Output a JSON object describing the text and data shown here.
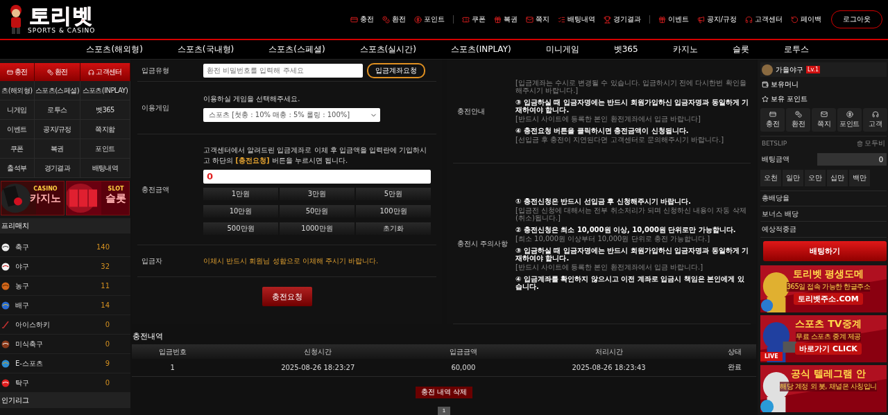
{
  "logo": {
    "title": "토리벳",
    "subtitle": "SPORTS & CASINO"
  },
  "top_links": [
    {
      "label": "충전"
    },
    {
      "label": "환전"
    },
    {
      "label": "포인트"
    },
    {
      "label": "쿠폰"
    },
    {
      "label": "복권"
    },
    {
      "label": "쪽지"
    },
    {
      "label": "배팅내역"
    },
    {
      "label": "경기결과"
    },
    {
      "label": "이벤트"
    },
    {
      "label": "공지/규정"
    },
    {
      "label": "고객센터"
    },
    {
      "label": "페이백"
    }
  ],
  "logout": "로그아웃",
  "main_nav": [
    "스포츠(해외형)",
    "스포츠(국내형)",
    "스포츠(스페셜)",
    "스포츠(실시간)",
    "스포츠(INPLAY)",
    "미니게임",
    "벳365",
    "카지노",
    "슬롯",
    "로투스"
  ],
  "sidebar": {
    "top_buttons": [
      "충전",
      "환전",
      "고객센터"
    ],
    "menu": [
      "츠(해외형)",
      "스포츠(스페셜)",
      "스포츠(INPLAY)",
      "니게임",
      "로투스",
      "벳365",
      "이벤트",
      "공지/규정",
      "쪽지함",
      "쿠폰",
      "복권",
      "포인트",
      "출석부",
      "경기결과",
      "배팅내역"
    ],
    "promos": [
      {
        "tag": "CASINO",
        "title": "카지노"
      },
      {
        "tag": "SLOT",
        "title": "슬롯"
      }
    ],
    "prematch_title": "프리매치",
    "sports": [
      {
        "kind": "soccer",
        "name": "축구",
        "count": "140"
      },
      {
        "kind": "baseball",
        "name": "야구",
        "count": "32"
      },
      {
        "kind": "basketball",
        "name": "농구",
        "count": "11"
      },
      {
        "kind": "volleyball",
        "name": "배구",
        "count": "14"
      },
      {
        "kind": "hockey",
        "name": "아이스하키",
        "count": "0"
      },
      {
        "kind": "football",
        "name": "미식축구",
        "count": "0"
      },
      {
        "kind": "esports",
        "name": "E-스포츠",
        "count": "9"
      },
      {
        "kind": "tabletennis",
        "name": "탁구",
        "count": "0"
      }
    ],
    "league_title": "인기리그"
  },
  "deposit_form": {
    "type_row": {
      "label": "입금유형",
      "placeholder": "환전 비밀번호를 입력해 주세요",
      "button": "입금계좌요청"
    },
    "game_row": {
      "label": "이용게임",
      "hint": "이용하실 게임을 선택해주세요.",
      "select_value": "스포츠 [첫충 : 10% 매충 : 5% 롤링 : 100%]"
    },
    "amount_row": {
      "label": "충전금액",
      "instruction": "고객센터에서 알려드린 입금계좌로 이체 후 입금액을 입력란에 기입하시고 하단의 **[충전요청]** 버튼을 누르시면 됩니다.",
      "value": "0",
      "quick_amounts": [
        "1만원",
        "3만원",
        "5만원",
        "10만원",
        "50만원",
        "100만원",
        "500만원",
        "1000만원",
        "초기화"
      ]
    },
    "depositor_row": {
      "label": "입금자",
      "notice": "이체시 반드시 회원님 성함으로 이체해 주시기 바랍니다."
    },
    "submit": "충전요청"
  },
  "info_sections": [
    {
      "title": "충전안내",
      "items": [
        {
          "note": "[입금계좌는 수시로 변경될 수 있습니다. 입금하시기 전에 다시한번 확인을 해주시기 바랍니다.]"
        },
        {
          "heading": "③ 입금하실 때 입금자명에는 반드시 회원가입하신 입금자명과 동일하게 기재하여야 합니다.",
          "note": "[반드시 사이트에 등록한 본인 환전계좌에서 입금 바랍니다]"
        },
        {
          "heading": "④ 충전요청 버튼을 클릭하시면 충전금액이 신청됩니다.",
          "note": "[선입금 후 충전이 지연된다면 고객센터로 문의해주시기 바랍니다.]"
        }
      ]
    },
    {
      "title": "충전시 주의사항",
      "items": [
        {
          "heading": "① 충전신청은 반드시 선입금 후 신청해주시기 바랍니다.",
          "note": "[입금전 신청에 대해서는 전부 취소처리가 되며 신청하신 내용이 자동 삭제(취소)됩니다.]"
        },
        {
          "heading": "② 충전신청은 최소 10,000원 이상, 10,000원 단위로만 가능합니다.",
          "note": "[최소 10,000원 이상부터 10,000원 단위로 충전 가능합니다.]"
        },
        {
          "heading": "③ 입금하실 때 입금자명에는 반드시 회원가입하신 입금자명과 동일하게 기재하여야 합니다.",
          "note": "[반드시 사이트에 등록한 본인 환전계좌에서 입금 바랍니다.]"
        },
        {
          "heading": "④ 입금계좌를 확인하지 않으시고 이전 계좌로 입금시 책임은 본인에게 있습니다."
        }
      ]
    }
  ],
  "history": {
    "title": "충전내역",
    "columns": [
      "입금번호",
      "신청시간",
      "입금금액",
      "처리시간",
      "상태"
    ],
    "rows": [
      [
        "1",
        "2025-08-26 18:23:27",
        "60,000",
        "2025-08-26 18:23:43",
        "완료"
      ]
    ],
    "delete_button": "충전 내역 삭제",
    "pages": [
      {
        "label": "1",
        "selected": true
      }
    ]
  },
  "right": {
    "user": {
      "name": "가을야구",
      "level": "Lv.1"
    },
    "balances": [
      "보유머니",
      "보유 포인트"
    ],
    "quick": [
      "충전",
      "환전",
      "쪽지",
      "포인트",
      "고객"
    ],
    "betslip": {
      "title": "BETSLIP",
      "clear": "모두비",
      "amount_label": "배팅금액",
      "amount_value": "0",
      "chips": [
        "오천",
        "일만",
        "오만",
        "십만",
        "백만"
      ],
      "rows": [
        "총배당율",
        "보너스 배당",
        "예상적중금"
      ],
      "submit": "배팅하기"
    },
    "banners": [
      {
        "kind": "domain",
        "title": "토리벳 평생도메",
        "subtitle": "365일 접속 가능한 한글주소",
        "cta": "토리벳주소.COM"
      },
      {
        "kind": "tv",
        "title": "스포츠 TV중계",
        "subtitle": "무료 스포츠 중계 제공",
        "cta": "바로가기 CLICK",
        "badge": "LIVE"
      },
      {
        "kind": "telegram",
        "title": "공식 텔레그램 안",
        "subtitle": "해당 계정 외 봇, 채널은 사칭입니"
      }
    ]
  }
}
